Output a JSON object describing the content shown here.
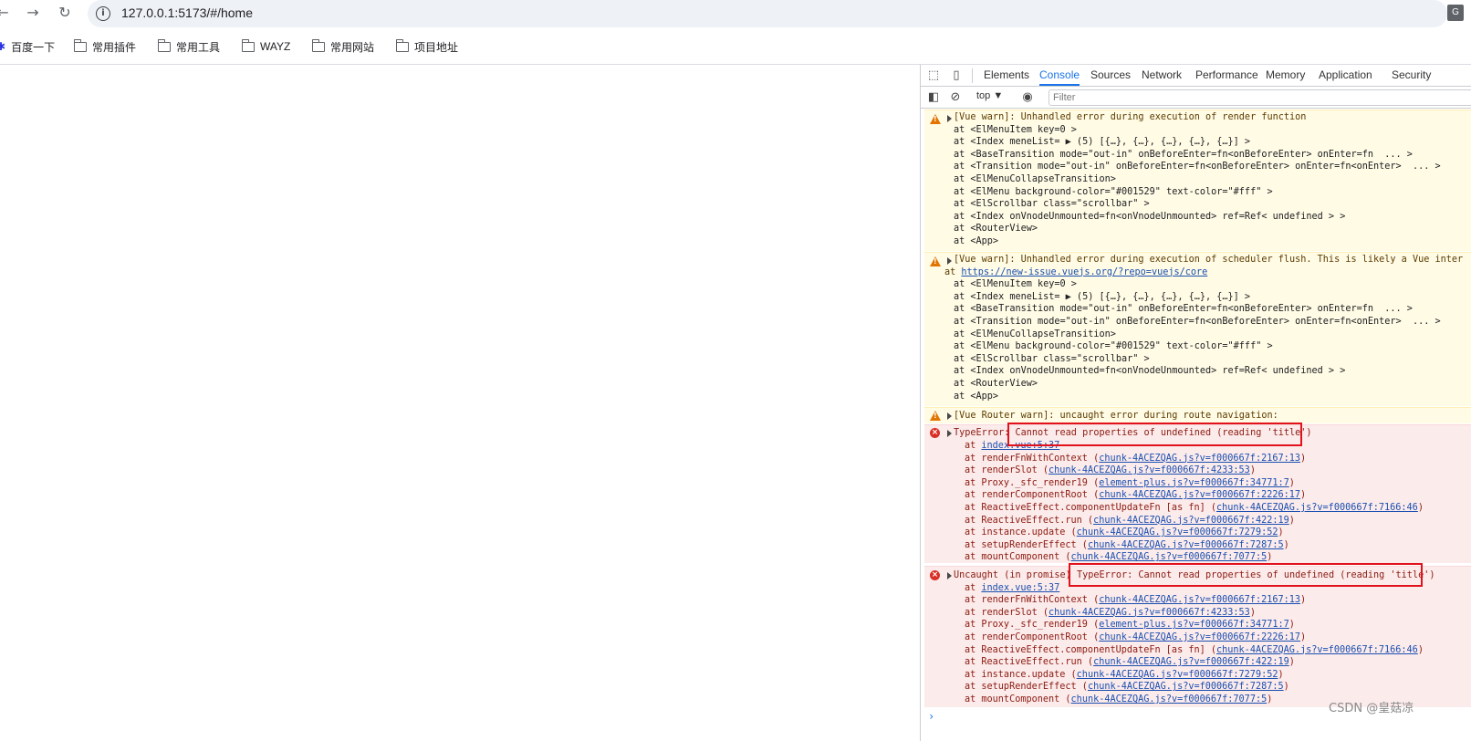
{
  "browser": {
    "url": "127.0.0.1:5173/#/home",
    "back_icon": "back-arrow-icon",
    "forward_icon": "forward-arrow-icon",
    "reload_icon": "reload-icon",
    "bookmarks": [
      "百度一下",
      "常用插件",
      "常用工具",
      "WAYZ",
      "常用网站",
      "项目地址"
    ]
  },
  "devtools": {
    "tabs": [
      "Elements",
      "Console",
      "Sources",
      "Network",
      "Performance",
      "Memory",
      "Application",
      "Security"
    ],
    "active_tab": "Console",
    "context": "top",
    "filter_placeholder": "Filter"
  },
  "console": {
    "warn1": {
      "head": "[Vue warn]: Unhandled error during execution of render function",
      "lines": [
        "at <ElMenuItem key=0 >",
        "at <Index meneList= ▶ (5) [{…}, {…}, {…}, {…}, {…}] >",
        "at <BaseTransition mode=\"out-in\" onBeforeEnter=fn<onBeforeEnter> onEnter=fn  ... >",
        "at <Transition mode=\"out-in\" onBeforeEnter=fn<onBeforeEnter> onEnter=fn<onEnter>  ... >",
        "at <ElMenuCollapseTransition>",
        "at <ElMenu background-color=\"#001529\" text-color=\"#fff\" >",
        "at <ElScrollbar class=\"scrollbar\" >",
        "at <Index onVnodeUnmounted=fn<onVnodeUnmounted> ref=Ref< undefined > >",
        "at <RouterView>",
        "at <App>"
      ]
    },
    "warn2": {
      "head": "[Vue warn]: Unhandled error during execution of scheduler flush. This is likely a Vue inter",
      "link_prefix": "at ",
      "link": "https://new-issue.vuejs.org/?repo=vuejs/core",
      "lines": [
        "at <ElMenuItem key=0 >",
        "at <Index meneList= ▶ (5) [{…}, {…}, {…}, {…}, {…}] >",
        "at <BaseTransition mode=\"out-in\" onBeforeEnter=fn<onBeforeEnter> onEnter=fn  ... >",
        "at <Transition mode=\"out-in\" onBeforeEnter=fn<onBeforeEnter> onEnter=fn<onEnter>  ... >",
        "at <ElMenuCollapseTransition>",
        "at <ElMenu background-color=\"#001529\" text-color=\"#fff\" >",
        "at <ElScrollbar class=\"scrollbar\" >",
        "at <Index onVnodeUnmounted=fn<onVnodeUnmounted> ref=Ref< undefined > >",
        "at <RouterView>",
        "at <App>"
      ]
    },
    "warn3": {
      "head": "[Vue Router warn]: uncaught error during route navigation:"
    },
    "error1": {
      "prefix": "TypeError: ",
      "highlight": "Cannot read properties of undefined (reading 'title')",
      "stack": [
        {
          "fn": "at ",
          "src": "index.vue:5:37"
        },
        {
          "fn": "at renderFnWithContext (",
          "src": "chunk-4ACEZQAG.js?v=f000667f:2167:13",
          "end": ")"
        },
        {
          "fn": "at renderSlot (",
          "src": "chunk-4ACEZQAG.js?v=f000667f:4233:53",
          "end": ")"
        },
        {
          "fn": "at Proxy._sfc_render19 (",
          "src": "element-plus.js?v=f000667f:34771:7",
          "end": ")"
        },
        {
          "fn": "at renderComponentRoot (",
          "src": "chunk-4ACEZQAG.js?v=f000667f:2226:17",
          "end": ")"
        },
        {
          "fn": "at ReactiveEffect.componentUpdateFn [as fn] (",
          "src": "chunk-4ACEZQAG.js?v=f000667f:7166:46",
          "end": ")"
        },
        {
          "fn": "at ReactiveEffect.run (",
          "src": "chunk-4ACEZQAG.js?v=f000667f:422:19",
          "end": ")"
        },
        {
          "fn": "at instance.update (",
          "src": "chunk-4ACEZQAG.js?v=f000667f:7279:52",
          "end": ")"
        },
        {
          "fn": "at setupRenderEffect (",
          "src": "chunk-4ACEZQAG.js?v=f000667f:7287:5",
          "end": ")"
        },
        {
          "fn": "at mountComponent (",
          "src": "chunk-4ACEZQAG.js?v=f000667f:7077:5",
          "end": ")"
        }
      ]
    },
    "error2": {
      "prefix": "Uncaught (in promise) ",
      "highlight": "TypeError: Cannot read properties of undefined (reading 'title')",
      "stack": [
        {
          "fn": "at ",
          "src": "index.vue:5:37"
        },
        {
          "fn": "at renderFnWithContext (",
          "src": "chunk-4ACEZQAG.js?v=f000667f:2167:13",
          "end": ")"
        },
        {
          "fn": "at renderSlot (",
          "src": "chunk-4ACEZQAG.js?v=f000667f:4233:53",
          "end": ")"
        },
        {
          "fn": "at Proxy._sfc_render19 (",
          "src": "element-plus.js?v=f000667f:34771:7",
          "end": ")"
        },
        {
          "fn": "at renderComponentRoot (",
          "src": "chunk-4ACEZQAG.js?v=f000667f:2226:17",
          "end": ")"
        },
        {
          "fn": "at ReactiveEffect.componentUpdateFn [as fn] (",
          "src": "chunk-4ACEZQAG.js?v=f000667f:7166:46",
          "end": ")"
        },
        {
          "fn": "at ReactiveEffect.run (",
          "src": "chunk-4ACEZQAG.js?v=f000667f:422:19",
          "end": ")"
        },
        {
          "fn": "at instance.update (",
          "src": "chunk-4ACEZQAG.js?v=f000667f:7279:52",
          "end": ")"
        },
        {
          "fn": "at setupRenderEffect (",
          "src": "chunk-4ACEZQAG.js?v=f000667f:7287:5",
          "end": ")"
        },
        {
          "fn": "at mountComponent (",
          "src": "chunk-4ACEZQAG.js?v=f000667f:7077:5",
          "end": ")"
        }
      ]
    },
    "prompt": "›"
  },
  "watermark": "CSDN @皇菇凉",
  "colors": {
    "warn_bg": "#fffbe5",
    "error_bg": "#fcebeb",
    "highlight_box": "#e1121c",
    "active_tab": "#1a73e8"
  }
}
